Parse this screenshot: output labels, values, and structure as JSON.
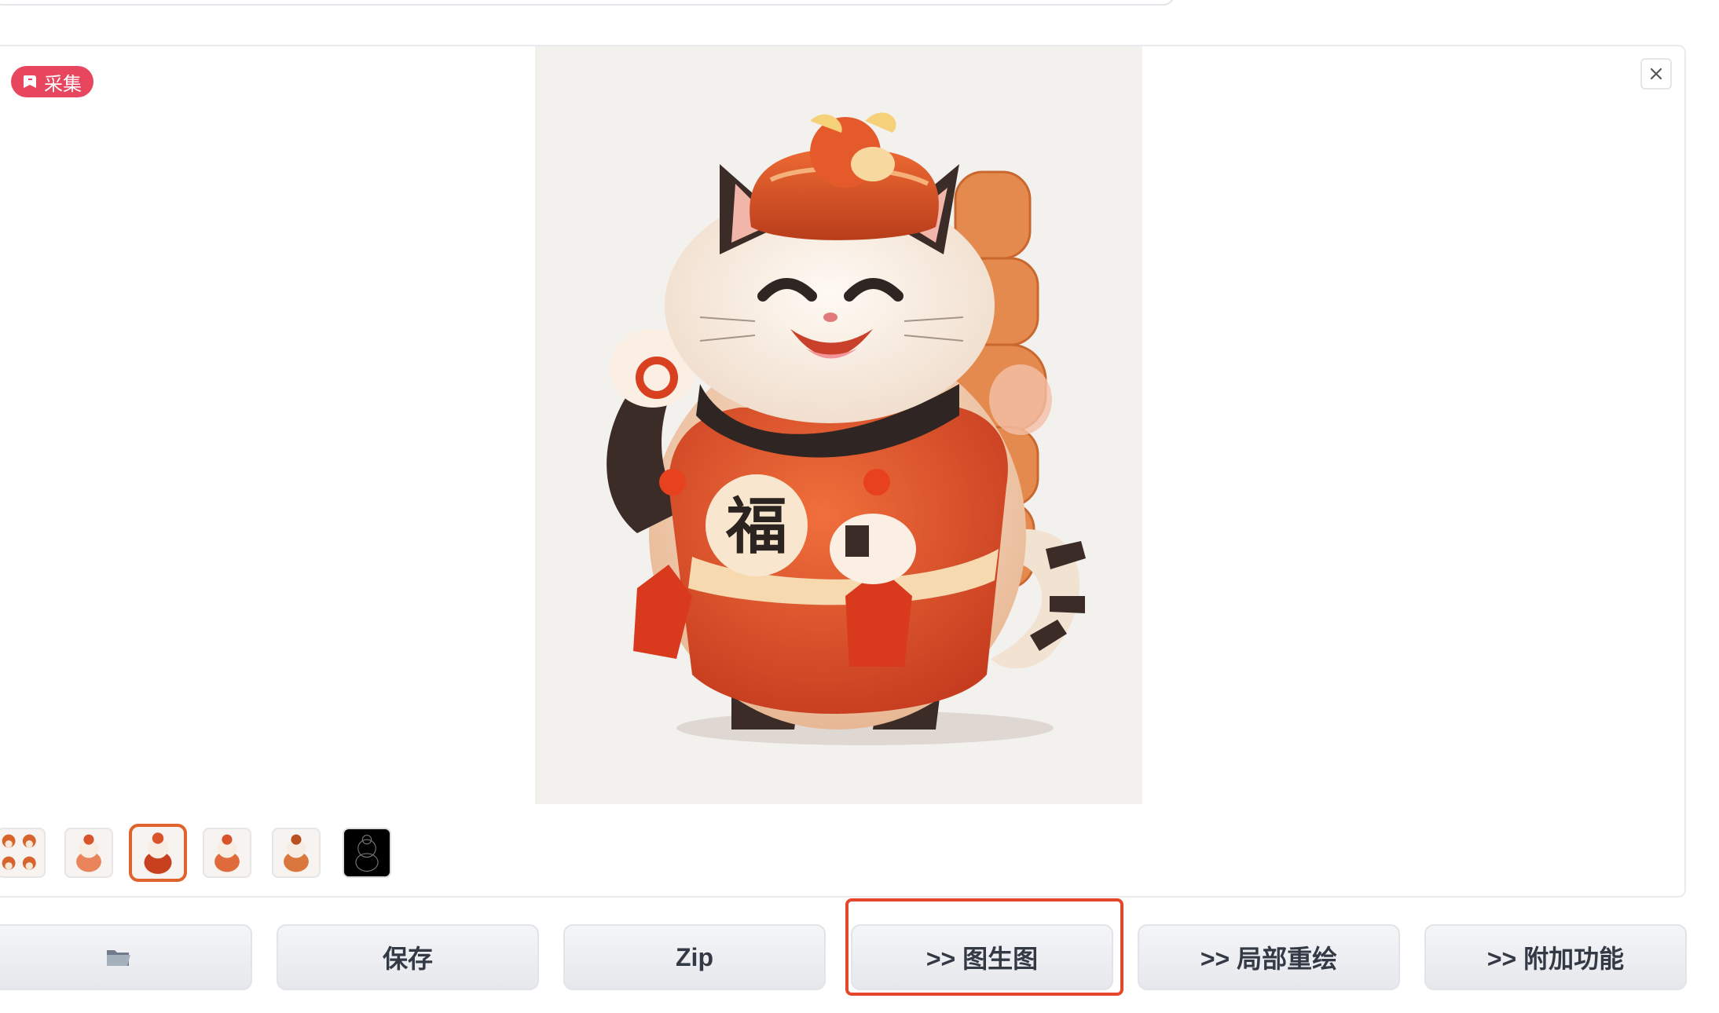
{
  "badge": {
    "label": "采集",
    "icon": "bookmark-icon",
    "color": "#e8455f"
  },
  "close": {
    "icon": "close-icon"
  },
  "main_image": {
    "description": "chubby lucky cat mascot holding coin, red apron with 福"
  },
  "mascot_char": "福",
  "thumbnails": [
    {
      "name": "grid-preview",
      "selected": false
    },
    {
      "name": "cat-1",
      "selected": false
    },
    {
      "name": "cat-2",
      "selected": true
    },
    {
      "name": "cat-3",
      "selected": false
    },
    {
      "name": "cat-4",
      "selected": false
    },
    {
      "name": "cat-lineart",
      "selected": false
    }
  ],
  "buttons": {
    "folder_icon": "folder-icon",
    "save": "保存",
    "zip": "Zip",
    "img2img": ">> 图生图",
    "inpaint": ">> 局部重绘",
    "extras": ">> 附加功能"
  },
  "colors": {
    "selection": "#e0622c",
    "highlight": "#e4472c"
  }
}
